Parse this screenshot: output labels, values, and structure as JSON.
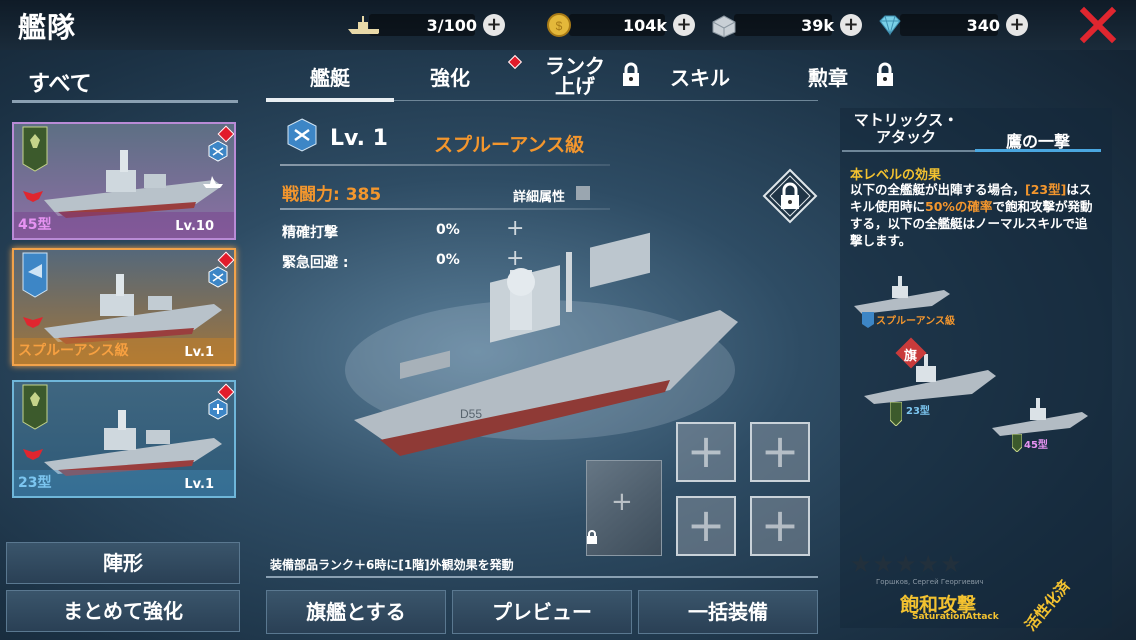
{
  "header": {
    "title": "艦隊",
    "fleet_count": "3/100",
    "coins": "104k",
    "steel": "39k",
    "gems": "340"
  },
  "left": {
    "tab_all": "すべて",
    "cards": [
      {
        "name": "45型",
        "level": "Lv.10"
      },
      {
        "name": "スプルーアンス級",
        "level": "Lv.1"
      },
      {
        "name": "23型",
        "level": "Lv.1"
      }
    ],
    "formation_button": "陣形",
    "bulk_enhance_button": "まとめて強化"
  },
  "tabs": {
    "ships": "艦艇",
    "enhance": "強化",
    "rank_up_line1": "ランク",
    "rank_up_line2": "上げ",
    "skill": "スキル",
    "medal": "勲章"
  },
  "ship": {
    "level": "Lv. 1",
    "class_name": "スプルーアンス級",
    "power": "戦闘力: 385",
    "details": "詳細属性",
    "stats": [
      {
        "label": "精確打撃",
        "value": "0%"
      },
      {
        "label": "緊急回避 :",
        "value": "0%"
      }
    ],
    "hull_number": "D55"
  },
  "notice": "装備部品ランク＋6時に[1階]外観効果を発動",
  "bottom_buttons": {
    "flagship": "旗艦とする",
    "preview": "プレビュー",
    "equip_all": "一括装備"
  },
  "right": {
    "tab_matrix": "マトリックス・アタック",
    "tab_matrix_l1": "マトリックス・",
    "tab_matrix_l2": "アタック",
    "tab_eagle": "鷹の一撃",
    "effect_title": "本レベルの効果",
    "effect_p1": "以下の全艦艇が出陣する場合，",
    "effect_hl1": "[23型]",
    "effect_p2": "はスキル使用時に",
    "effect_hl2": "50%の確率",
    "effect_p3": "で飽和攻撃が発動する，以下の全艦艇はノーマルスキルで追撃します。",
    "ships": [
      "スプルーアンス級",
      "23型",
      "45型"
    ],
    "flag_mark": "旗",
    "author": "Горшков, Сергей Георгиевич",
    "skill_name": "飽和攻撃",
    "skill_en": "SaturationAttack",
    "activate": "活性化済"
  },
  "colors": {
    "accent_orange": "#f3962d",
    "accent_gold": "#f3c230",
    "alert_red": "#e21b2a",
    "badge_blue": "#3d86c6"
  }
}
